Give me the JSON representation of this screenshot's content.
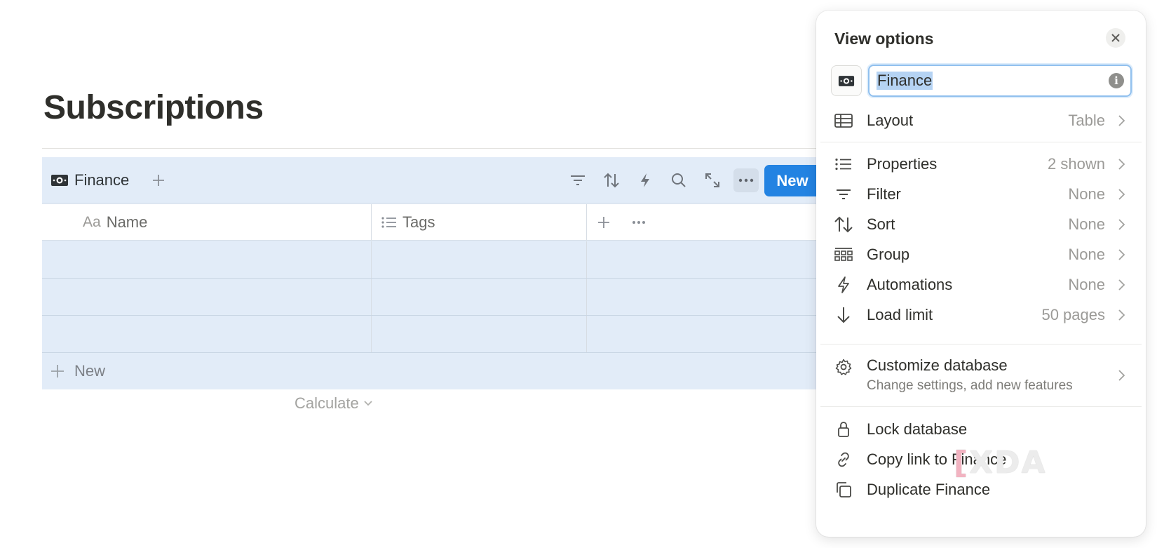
{
  "page": {
    "title": "Subscriptions"
  },
  "database": {
    "view_name": "Finance",
    "new_button": "New",
    "columns": [
      {
        "label": "Name",
        "type_icon": "Aa"
      },
      {
        "label": "Tags",
        "type_icon": "list-icon"
      }
    ],
    "row_count_visible": 3,
    "new_row_label": "New",
    "calculate_label": "Calculate",
    "colors": {
      "accent": "#2383e2",
      "table_bg": "#e2ecf8"
    }
  },
  "view_options": {
    "title": "View options",
    "name_input_value": "Finance",
    "layout": {
      "label": "Layout",
      "value": "Table"
    },
    "items": [
      {
        "label": "Properties",
        "value": "2 shown",
        "icon": "list-icon"
      },
      {
        "label": "Filter",
        "value": "None",
        "icon": "filter-icon"
      },
      {
        "label": "Sort",
        "value": "None",
        "icon": "sort-icon"
      },
      {
        "label": "Group",
        "value": "None",
        "icon": "group-icon"
      },
      {
        "label": "Automations",
        "value": "None",
        "icon": "lightning-icon"
      },
      {
        "label": "Load limit",
        "value": "50 pages",
        "icon": "arrow-down-icon"
      }
    ],
    "customize": {
      "label": "Customize database",
      "subtitle": "Change settings, add new features"
    },
    "actions": [
      {
        "label": "Lock database",
        "icon": "lock-icon"
      },
      {
        "label": "Copy link to Finance",
        "icon": "link-icon"
      },
      {
        "label": "Duplicate Finance",
        "icon": "duplicate-icon"
      }
    ]
  },
  "watermark": "XDA"
}
